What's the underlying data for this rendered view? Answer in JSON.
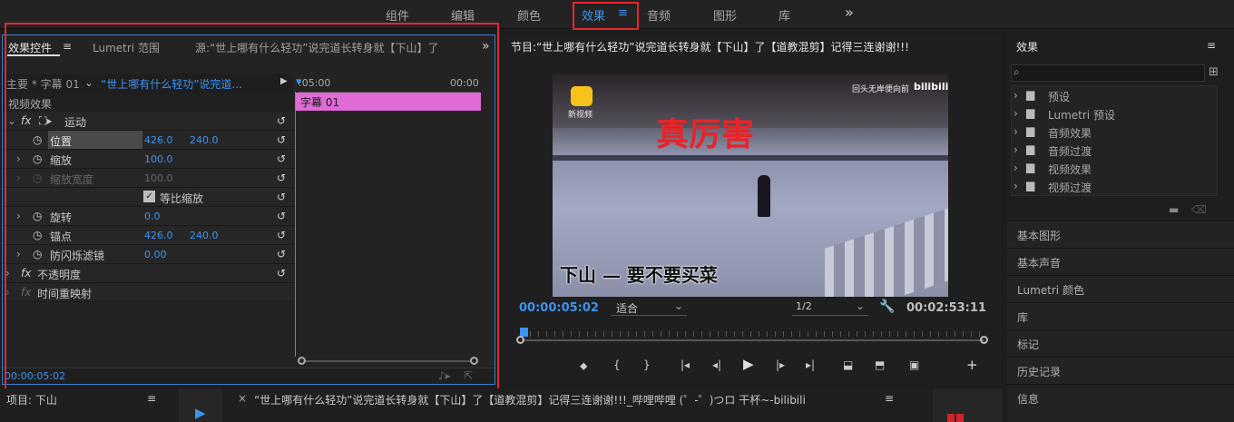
{
  "workspace": {
    "tabs": [
      "组件",
      "编辑",
      "颜色",
      "效果",
      "音频",
      "图形",
      "库"
    ],
    "active": "效果",
    "overflow": "»"
  },
  "effect_controls": {
    "tabs": {
      "controls": "效果控件",
      "lumetri": "Lumetri 范围",
      "source": "源:“世上哪有什么轻功”说完道长转身就【下山】了"
    },
    "overflow": "»",
    "master_label": "主要 * 字幕 01",
    "clip_dropdown": "“世上哪有什么轻功”说完道...",
    "time_start": ":05:00",
    "time_end": "00:00",
    "clip_bar_label": "字幕 01",
    "section": "视频效果",
    "motion": "运动",
    "rows": {
      "position": {
        "label": "位置",
        "x": "426.0",
        "y": "240.0"
      },
      "scale": {
        "label": "缩放",
        "value": "100.0"
      },
      "scale_width": {
        "label": "缩放宽度",
        "value": "100.0"
      },
      "uniform": {
        "label": "等比缩放"
      },
      "rotation": {
        "label": "旋转",
        "value": "0.0"
      },
      "anchor": {
        "label": "锚点",
        "x": "426.0",
        "y": "240.0"
      },
      "flicker": {
        "label": "防闪烁滤镜",
        "value": "0.00"
      },
      "opacity": {
        "label": "不透明度"
      },
      "time_remap": {
        "label": "时间重映射"
      }
    },
    "timecode": "00:00:05:02"
  },
  "program": {
    "title": "节目:“世上哪有什么轻功”说完道长转身就【下山】了【道教混剪】记得三连谢谢!!!",
    "video": {
      "logo_text": "新视频",
      "watermark": "回头无岸便向前",
      "brand": "bilibili",
      "headline": "真厉害",
      "subtitle": "下山 — 要不要买菜",
      "colors": {
        "headline": "#e8242a"
      }
    },
    "timecode": "00:00:05:02",
    "fit": "适合",
    "resolution": "1/2",
    "duration": "00:02:53:11"
  },
  "effects_panel": {
    "title": "效果",
    "search_placeholder": "",
    "folders": [
      "预设",
      "Lumetri 预设",
      "音频效果",
      "音频过渡",
      "视频效果",
      "视频过渡"
    ],
    "sections": [
      "基本图形",
      "基本声音",
      "Lumetri 颜色",
      "库",
      "标记",
      "历史记录",
      "信息"
    ]
  },
  "bottom": {
    "project": "项目: 下山",
    "sequence_tab": "“世上哪有什么轻功”说完道长转身就【下山】了【道教混剪】记得三连谢谢!!!_哔哩哔哩 (゜-゜)つロ 干杯~-bilibili"
  },
  "colors": {
    "accent": "#3a94f0",
    "highlight": "#e6262e",
    "clip": "#e06ad6"
  }
}
